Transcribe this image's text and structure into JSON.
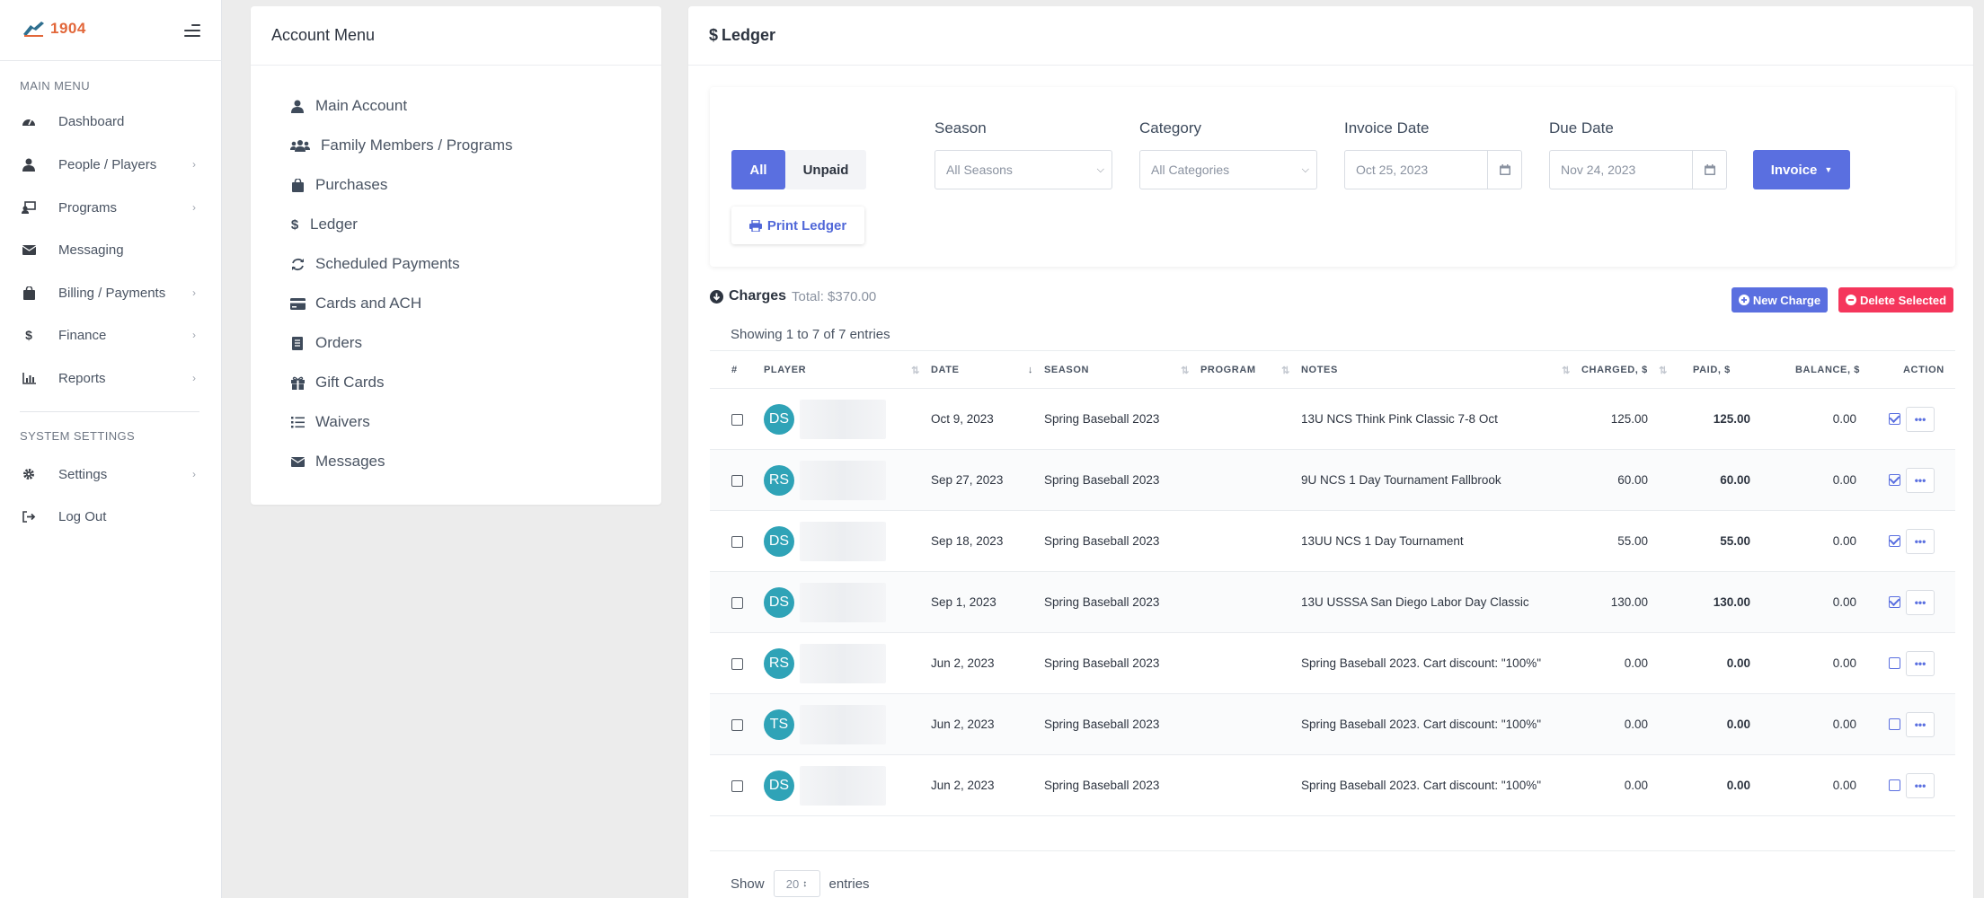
{
  "brand": {
    "logo_text": "1904"
  },
  "sidebar": {
    "main_menu_label": "MAIN MENU",
    "system_settings_label": "SYSTEM SETTINGS",
    "items": [
      {
        "label": "Dashboard",
        "icon": "gauge-icon",
        "has_children": false
      },
      {
        "label": "People / Players",
        "icon": "user-icon",
        "has_children": true
      },
      {
        "label": "Programs",
        "icon": "programs-icon",
        "has_children": true
      },
      {
        "label": "Messaging",
        "icon": "envelope-icon",
        "has_children": false
      },
      {
        "label": "Billing / Payments",
        "icon": "bag-icon",
        "has_children": true
      },
      {
        "label": "Finance",
        "icon": "dollar-icon",
        "has_children": true
      },
      {
        "label": "Reports",
        "icon": "chart-icon",
        "has_children": true
      }
    ],
    "settings_items": [
      {
        "label": "Settings",
        "icon": "gear-icon",
        "has_children": true
      },
      {
        "label": "Log Out",
        "icon": "logout-icon",
        "has_children": false
      }
    ]
  },
  "account_menu": {
    "title": "Account Menu",
    "items": [
      {
        "label": "Main Account",
        "icon": "user-icon"
      },
      {
        "label": "Family Members / Programs",
        "icon": "users-icon"
      },
      {
        "label": "Purchases",
        "icon": "bag-icon"
      },
      {
        "label": "Ledger",
        "icon": "dollar-icon"
      },
      {
        "label": "Scheduled Payments",
        "icon": "refresh-icon"
      },
      {
        "label": "Cards and ACH",
        "icon": "credit-card-icon"
      },
      {
        "label": "Orders",
        "icon": "receipt-icon"
      },
      {
        "label": "Gift Cards",
        "icon": "gift-icon"
      },
      {
        "label": "Waivers",
        "icon": "list-icon"
      },
      {
        "label": "Messages",
        "icon": "envelope-icon"
      }
    ]
  },
  "ledger": {
    "title": "Ledger",
    "filters": {
      "all_label": "All",
      "unpaid_label": "Unpaid",
      "print_label": "Print Ledger",
      "season_label": "Season",
      "season_value": "All Seasons",
      "category_label": "Category",
      "category_value": "All Categories",
      "invoice_date_label": "Invoice Date",
      "invoice_date_value": "Oct 25, 2023",
      "due_date_label": "Due Date",
      "due_date_value": "Nov 24, 2023",
      "invoice_button": "Invoice"
    },
    "charges_label": "Charges",
    "total_label": "Total: $370.00",
    "new_charge_label": "New Charge",
    "delete_selected_label": "Delete Selected",
    "showing_text": "Showing 1 to 7 of 7 entries",
    "columns": [
      "#",
      "PLAYER",
      "DATE",
      "SEASON",
      "PROGRAM",
      "NOTES",
      "CHARGED, $",
      "PAID, $",
      "BALANCE, $",
      "ACTION"
    ],
    "rows": [
      {
        "initials": "DS",
        "date": "Oct 9, 2023",
        "season": "Spring Baseball 2023",
        "program": "",
        "notes": "13U NCS Think Pink Classic 7-8 Oct",
        "charged": "125.00",
        "paid": "125.00",
        "balance": "0.00",
        "action_checked": true
      },
      {
        "initials": "RS",
        "date": "Sep 27, 2023",
        "season": "Spring Baseball 2023",
        "program": "",
        "notes": "9U NCS 1 Day Tournament Fallbrook",
        "charged": "60.00",
        "paid": "60.00",
        "balance": "0.00",
        "action_checked": true
      },
      {
        "initials": "DS",
        "date": "Sep 18, 2023",
        "season": "Spring Baseball 2023",
        "program": "",
        "notes": "13UU NCS 1 Day Tournament",
        "charged": "55.00",
        "paid": "55.00",
        "balance": "0.00",
        "action_checked": true
      },
      {
        "initials": "DS",
        "date": "Sep 1, 2023",
        "season": "Spring Baseball 2023",
        "program": "",
        "notes": "13U USSSA San Diego Labor Day Classic",
        "charged": "130.00",
        "paid": "130.00",
        "balance": "0.00",
        "action_checked": true
      },
      {
        "initials": "RS",
        "date": "Jun 2, 2023",
        "season": "Spring Baseball 2023",
        "program": "",
        "notes": "Spring Baseball 2023. Cart discount: \"100%\"",
        "charged": "0.00",
        "paid": "0.00",
        "balance": "0.00",
        "action_checked": false
      },
      {
        "initials": "TS",
        "date": "Jun 2, 2023",
        "season": "Spring Baseball 2023",
        "program": "",
        "notes": "Spring Baseball 2023. Cart discount: \"100%\"",
        "charged": "0.00",
        "paid": "0.00",
        "balance": "0.00",
        "action_checked": false
      },
      {
        "initials": "DS",
        "date": "Jun 2, 2023",
        "season": "Spring Baseball 2023",
        "program": "",
        "notes": "Spring Baseball 2023. Cart discount: \"100%\"",
        "charged": "0.00",
        "paid": "0.00",
        "balance": "0.00",
        "action_checked": false
      }
    ],
    "show_label": "Show",
    "show_value": "20",
    "entries_label": "entries"
  },
  "colors": {
    "accent": "#5a6fe0",
    "danger": "#f5365c",
    "avatar": "#2fa3b7",
    "brand": "#e2673a"
  }
}
